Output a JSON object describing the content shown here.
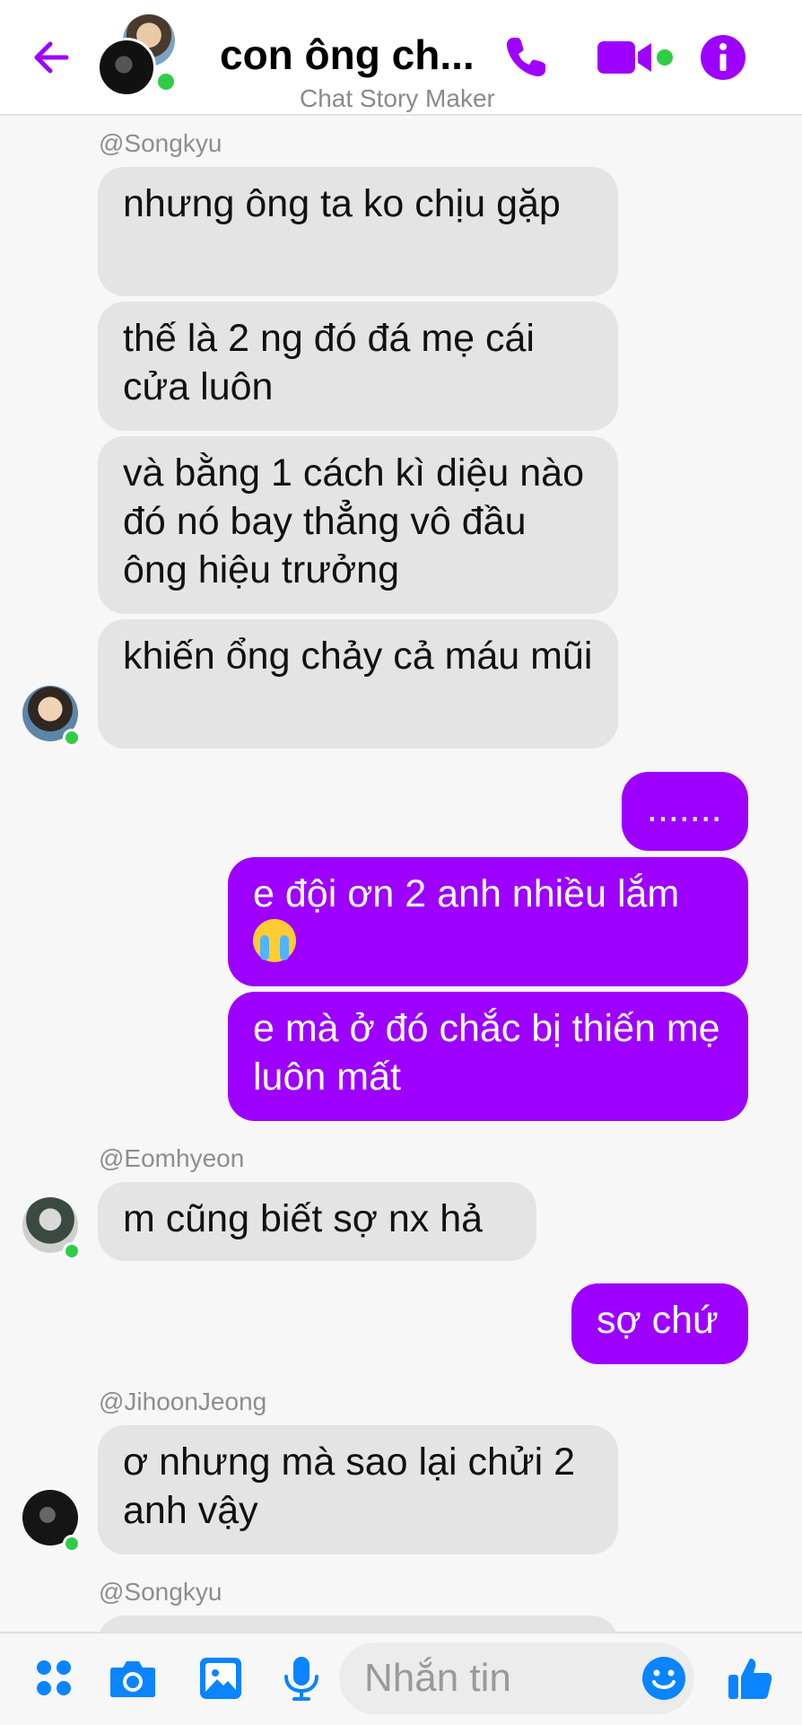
{
  "header": {
    "title": "con ông ch...",
    "subtitle": "Chat Story Maker",
    "accent_color": "#9d00ff",
    "icons": [
      "back-arrow-icon",
      "phone-icon",
      "video-camera-icon",
      "info-icon"
    ]
  },
  "messages": [
    {
      "type": "in",
      "username": "@Songkyu",
      "text": "nhưng ông ta ko chịu gặp"
    },
    {
      "type": "in",
      "text": "thế là 2 ng đó đá mẹ cái cửa luôn"
    },
    {
      "type": "in",
      "text": "và bằng 1 cách kì diệu nào đó nó bay thẳng vô đầu ông hiệu trưởng"
    },
    {
      "type": "in",
      "text": "khiến ổng chảy cả máu mũi"
    },
    {
      "type": "out",
      "text": "......."
    },
    {
      "type": "out",
      "text": "e đội ơn 2 anh nhiều lắm",
      "emoji": "loudly-crying-face"
    },
    {
      "type": "out",
      "text": "e mà ở đó chắc bị thiến mẹ luôn mất"
    },
    {
      "type": "in",
      "username": "@Eomhyeon",
      "text": "m cũng biết sợ nx hả"
    },
    {
      "type": "out",
      "text": "sợ chứ"
    },
    {
      "type": "in",
      "username": "@JihoonJeong",
      "text": "ơ nhưng mà sao lại chửi 2 anh vậy"
    },
    {
      "type": "in",
      "username": "@Songkyu",
      "text": ""
    }
  ],
  "composer": {
    "placeholder": "Nhắn tin",
    "icons": [
      "apps-icon",
      "camera-icon",
      "gallery-icon",
      "microphone-icon",
      "emoji-icon",
      "thumbs-up-icon"
    ]
  }
}
